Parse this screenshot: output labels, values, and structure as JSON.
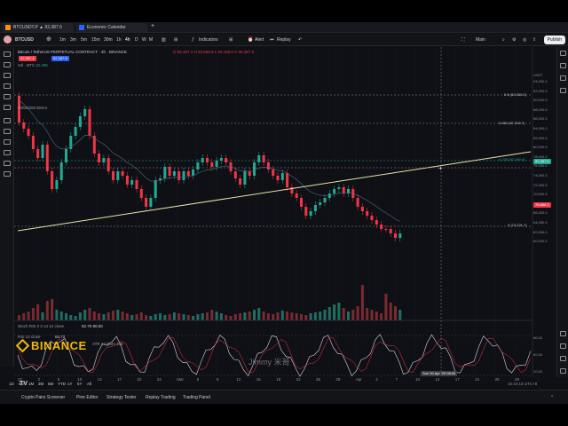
{
  "browser": {
    "tabs": [
      {
        "label": "BTCUSDT.P ▲ 92,387.5",
        "color": "#f7931a"
      },
      {
        "label": "Economic Calendar",
        "color": "#2962ff"
      }
    ]
  },
  "toolbar": {
    "symbol": "BTCUSD",
    "intervals": [
      "1m",
      "3m",
      "5m",
      "15m",
      "30m",
      "1h",
      "4h",
      "D",
      "W",
      "M"
    ],
    "indicators_label": "Indicators",
    "alert_label": "Alert",
    "replay_label": "Replay",
    "layout_label": "Main",
    "publish_label": "Publish"
  },
  "legend": {
    "title": "Bitcoin / TetherUS PERPETUAL CONTRACT · 4h · BINANCE",
    "ohlc": "O 92,487.1  H 92,559.9  L 92,166.0  C 92,387.5",
    "price_tag_sell": "92,387.4",
    "price_tag_buy": "92,387.5",
    "vol_label": "Vol · BTC",
    "vol_value": "10.49K",
    "ma_label": "20/50/200 EMAs"
  },
  "price_axis": {
    "currency": "USDT",
    "ticks": [
      "94,000.0",
      "92,000.0",
      "90,000.0",
      "88,000.0",
      "86,000.0",
      "84,000.0",
      "82,000.0",
      "80,000.0",
      "78,000.0",
      "76,000.0",
      "74,000.0",
      "72,000.0",
      "70,000.0",
      "68,000.0",
      "66,000.0",
      "64,000.0",
      "62,000.0",
      "60,000.0"
    ],
    "current_price": "92,387.5",
    "current_price_color": "#22ab94",
    "low_marker": "76,666.0",
    "low_marker_color": "#f23645",
    "oscillator_ticks": [
      "80.00",
      "50.00",
      "20.00"
    ]
  },
  "fib_levels": [
    {
      "label": "0.5 (92,000.0)"
    },
    {
      "label": "0.382 (87,333.7)"
    },
    {
      "label": "0.236 (82,189.4)"
    },
    {
      "label": "0 (74,131.7)"
    }
  ],
  "oscillator": {
    "legend1": "Stoch RSI 3 3 14 14 close",
    "legend1_values": "62.75  80.50",
    "legend2": "RSI 14 close",
    "legend2_value": "64.72",
    "legend3": "ATR 14 RMA 100"
  },
  "time_axis": {
    "ticks": [
      "27",
      "3",
      "6",
      "10",
      "13",
      "17",
      "20",
      "24",
      "Mar",
      "5",
      "8",
      "12",
      "16",
      "19",
      "22",
      "26",
      "29",
      "Apr",
      "4",
      "7",
      "10",
      "13",
      "17",
      "21",
      "25",
      "29"
    ],
    "crosshair_label": "Sun 20 Apr '25  08:00",
    "clock": "10:10:18 UTC+8"
  },
  "ranges": [
    "1D",
    "5D",
    "1M",
    "3M",
    "6M",
    "YTD",
    "1Y",
    "5Y",
    "All"
  ],
  "panel_tabs": [
    "Crypto Pairs Screener",
    "Pine Editor",
    "Strategy Tester",
    "Replay Trading",
    "Trading Panel"
  ],
  "branding": {
    "binance": "BINANCE",
    "watermark": "Jimmy 米哥",
    "tv": "TV"
  },
  "colors": {
    "up": "#22ab94",
    "down": "#f23645",
    "trendline": "#e8e4a8",
    "accent": "#2962ff"
  }
}
